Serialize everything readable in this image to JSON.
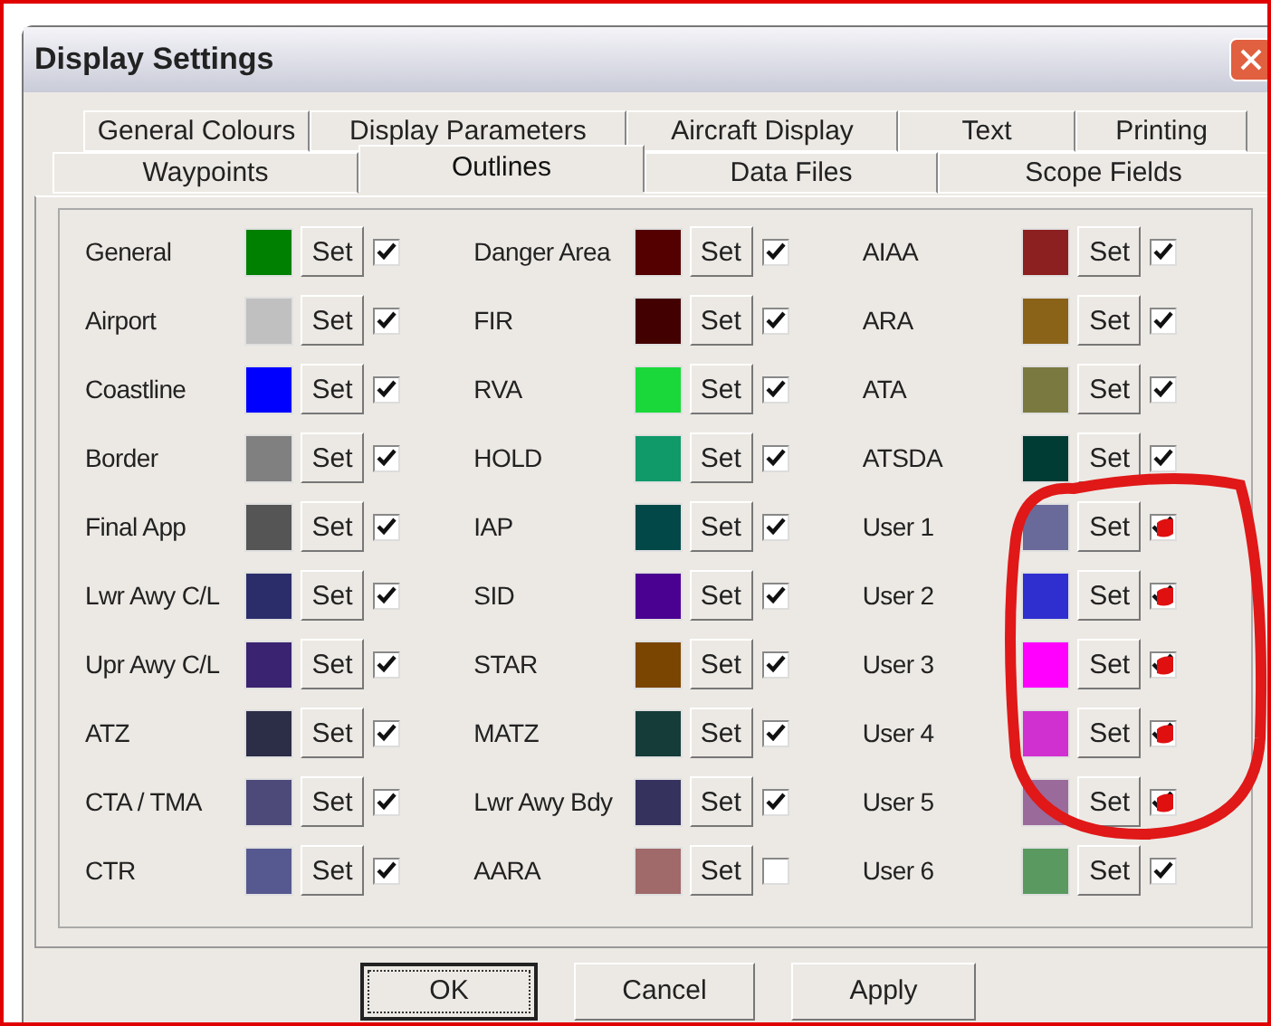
{
  "window": {
    "title": "Display Settings"
  },
  "tabs": [
    [
      {
        "label": "General Colours",
        "selected": false
      },
      {
        "label": "Display Parameters",
        "selected": false
      },
      {
        "label": "Aircraft Display",
        "selected": false
      },
      {
        "label": "Text",
        "selected": false
      },
      {
        "label": "Printing",
        "selected": false
      }
    ],
    [
      {
        "label": "Waypoints",
        "selected": false
      },
      {
        "label": "Outlines",
        "selected": true
      },
      {
        "label": "Data Files",
        "selected": false
      },
      {
        "label": "Scope Fields",
        "selected": false
      }
    ]
  ],
  "columns": [
    [
      {
        "label": "General",
        "set_label": "Set",
        "color": "#008000",
        "kind": "checkbox",
        "checked": true
      },
      {
        "label": "Airport",
        "set_label": "Set",
        "color": "#c0c0c0",
        "kind": "checkbox",
        "checked": true
      },
      {
        "label": "Coastline",
        "set_label": "Set",
        "color": "#0000ff",
        "kind": "checkbox",
        "checked": true
      },
      {
        "label": "Border",
        "set_label": "Set",
        "color": "#808080",
        "kind": "checkbox",
        "checked": true
      },
      {
        "label": "Final App",
        "set_label": "Set",
        "color": "#555555",
        "kind": "checkbox",
        "checked": true
      },
      {
        "label": "Lwr Awy C/L",
        "set_label": "Set",
        "color": "#2b2d6b",
        "kind": "checkbox",
        "checked": true
      },
      {
        "label": "Upr Awy C/L",
        "set_label": "Set",
        "color": "#3a2370",
        "kind": "checkbox",
        "checked": true
      },
      {
        "label": "ATZ",
        "set_label": "Set",
        "color": "#2c2d47",
        "kind": "checkbox",
        "checked": true
      },
      {
        "label": "CTA / TMA",
        "set_label": "Set",
        "color": "#4d4a7a",
        "kind": "checkbox",
        "checked": true
      },
      {
        "label": "CTR",
        "set_label": "Set",
        "color": "#56598f",
        "kind": "checkbox",
        "checked": true
      }
    ],
    [
      {
        "label": "Danger Area",
        "set_label": "Set",
        "color": "#550000",
        "kind": "checkbox",
        "checked": true
      },
      {
        "label": "FIR",
        "set_label": "Set",
        "color": "#420000",
        "kind": "checkbox",
        "checked": true
      },
      {
        "label": "RVA",
        "set_label": "Set",
        "color": "#1ad83a",
        "kind": "checkbox",
        "checked": true
      },
      {
        "label": "HOLD",
        "set_label": "Set",
        "color": "#109a6a",
        "kind": "checkbox",
        "checked": true
      },
      {
        "label": "IAP",
        "set_label": "Set",
        "color": "#034848",
        "kind": "checkbox",
        "checked": true
      },
      {
        "label": "SID",
        "set_label": "Set",
        "color": "#4a0090",
        "kind": "checkbox",
        "checked": true
      },
      {
        "label": "STAR",
        "set_label": "Set",
        "color": "#7a4500",
        "kind": "checkbox",
        "checked": true
      },
      {
        "label": "MATZ",
        "set_label": "Set",
        "color": "#153c38",
        "kind": "checkbox",
        "checked": true
      },
      {
        "label": "Lwr Awy Bdy",
        "set_label": "Set",
        "color": "#36325e",
        "kind": "checkbox",
        "checked": true
      },
      {
        "label": "AARA",
        "set_label": "Set",
        "color": "#a06a6a",
        "kind": "checkbox",
        "checked": false
      }
    ],
    [
      {
        "label": "AIAA",
        "set_label": "Set",
        "color": "#8c2020",
        "kind": "checkbox",
        "checked": true
      },
      {
        "label": "ARA",
        "set_label": "Set",
        "color": "#8a6318",
        "kind": "checkbox",
        "checked": true
      },
      {
        "label": "ATA",
        "set_label": "Set",
        "color": "#7a7a40",
        "kind": "checkbox",
        "checked": true
      },
      {
        "label": "ATSDA",
        "set_label": "Set",
        "color": "#003c34",
        "kind": "checkbox",
        "checked": true
      },
      {
        "label": "User 1",
        "set_label": "Set",
        "color": "#6a6a9a",
        "kind": "scribbled",
        "checked": true
      },
      {
        "label": "User 2",
        "set_label": "Set",
        "color": "#2f2fd0",
        "kind": "scribbled",
        "checked": true
      },
      {
        "label": "User 3",
        "set_label": "Set",
        "color": "#ff00ff",
        "kind": "scribbled",
        "checked": true
      },
      {
        "label": "User 4",
        "set_label": "Set",
        "color": "#d030d0",
        "kind": "scribbled",
        "checked": true
      },
      {
        "label": "User 5",
        "set_label": "Set",
        "color": "#9a6a9a",
        "kind": "scribbled",
        "checked": true
      },
      {
        "label": "User 6",
        "set_label": "Set",
        "color": "#5a9a60",
        "kind": "checkbox",
        "checked": true
      }
    ]
  ],
  "annotation_circle": true,
  "buttons": [
    {
      "label": "OK",
      "focused": true
    },
    {
      "label": "Cancel",
      "focused": false
    },
    {
      "label": "Apply",
      "focused": false
    }
  ]
}
